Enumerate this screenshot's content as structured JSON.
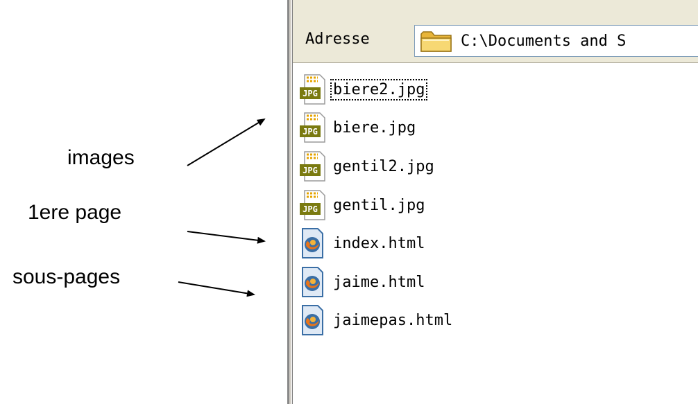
{
  "annotations": [
    {
      "id": "images",
      "text": "images"
    },
    {
      "id": "first-page",
      "text": "1ere page"
    },
    {
      "id": "sub-pages",
      "text": "sous-pages"
    }
  ],
  "explorer": {
    "address_label": "Adresse",
    "address_path": "C:\\Documents and S",
    "files": [
      {
        "name": "biere2.jpg",
        "icon": "jpg-file-icon",
        "focused": true
      },
      {
        "name": "biere.jpg",
        "icon": "jpg-file-icon",
        "focused": false
      },
      {
        "name": "gentil2.jpg",
        "icon": "jpg-file-icon",
        "focused": false
      },
      {
        "name": "gentil.jpg",
        "icon": "jpg-file-icon",
        "focused": false
      },
      {
        "name": "index.html",
        "icon": "firefox-html-file-icon",
        "focused": false
      },
      {
        "name": "jaime.html",
        "icon": "firefox-html-file-icon",
        "focused": false
      },
      {
        "name": "jaimepas.html",
        "icon": "firefox-html-file-icon",
        "focused": false
      }
    ]
  },
  "colors": {
    "chrome_bg": "#ece9d8",
    "jpg_badge": "#7a7a10",
    "html_badge": "#3a6ea5"
  }
}
